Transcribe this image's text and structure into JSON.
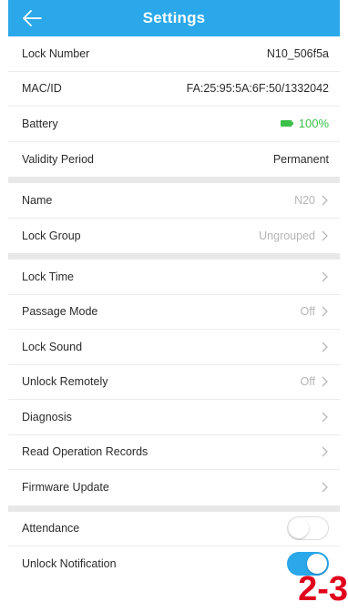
{
  "header": {
    "title": "Settings",
    "back_icon": "arrow-left-icon"
  },
  "info": [
    {
      "label": "Lock Number",
      "value": "N10_506f5a"
    },
    {
      "label": "MAC/ID",
      "value": "FA:25:95:5A:6F:50/1332042"
    },
    {
      "label": "Battery",
      "value": "100%"
    },
    {
      "label": "Validity Period",
      "value": "Permanent"
    }
  ],
  "naming": [
    {
      "label": "Name",
      "value": "N20"
    },
    {
      "label": "Lock Group",
      "value": "Ungrouped"
    }
  ],
  "options": [
    {
      "label": "Lock Time",
      "value": ""
    },
    {
      "label": "Passage Mode",
      "value": "Off"
    },
    {
      "label": "Lock Sound",
      "value": ""
    },
    {
      "label": "Unlock Remotely",
      "value": "Off"
    },
    {
      "label": "Diagnosis",
      "value": ""
    },
    {
      "label": "Read Operation Records",
      "value": ""
    },
    {
      "label": "Firmware Update",
      "value": ""
    }
  ],
  "toggles": [
    {
      "label": "Attendance",
      "on": false
    },
    {
      "label": "Unlock Notification",
      "on": true
    }
  ],
  "stamp": "2-3",
  "colors": {
    "accent": "#2aa8ea",
    "battery": "#3cc04a",
    "stamp": "#e0001c",
    "divider": "#e8e8e8"
  }
}
